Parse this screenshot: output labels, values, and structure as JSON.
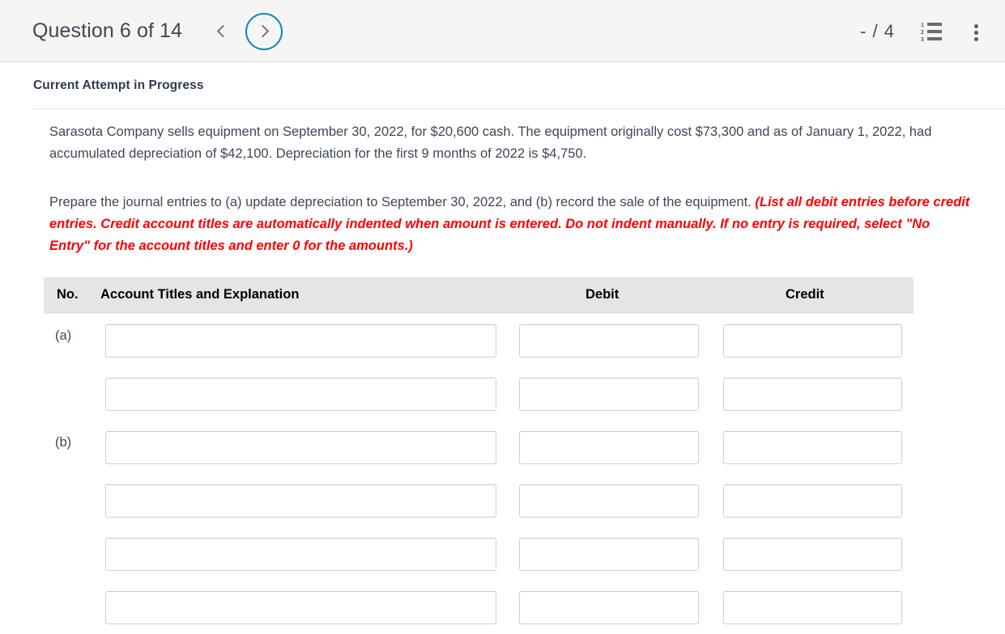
{
  "header": {
    "question_title": "Question 6 of 14",
    "prev_label": "Previous question",
    "next_label": "Next question",
    "score": "- / 4",
    "list_icon_label": "Question list",
    "menu_icon_label": "More options",
    "list_numbers": [
      "1",
      "2",
      "3"
    ],
    "accent_color": "#1387b2",
    "background_color": "#f5f5f5"
  },
  "attempt": {
    "status": "Current Attempt in Progress"
  },
  "question": {
    "paragraph_1": "Sarasota Company sells equipment on September 30, 2022, for $20,600 cash. The equipment originally cost $73,300 and as of January 1, 2022, had accumulated depreciation of $42,100. Depreciation for the first 9 months of 2022 is $4,750.",
    "paragraph_2_plain": "Prepare the journal entries to (a) update depreciation to September 30, 2022, and (b) record the sale of the equipment. ",
    "paragraph_2_italic": "(List all debit entries before credit entries. Credit account titles are automatically indented when amount is entered. Do not indent manually. If no entry is required, select \"No Entry\" for the account titles and enter 0 for the amounts.)",
    "instruction_color": "#ff0000"
  },
  "table": {
    "headers": {
      "no": "No.",
      "account": "Account Titles and Explanation",
      "debit": "Debit",
      "credit": "Credit"
    },
    "header_background": "#e5e5e5",
    "rows": [
      {
        "label": "(a)",
        "account": "",
        "debit": "",
        "credit": ""
      },
      {
        "label": "",
        "account": "",
        "debit": "",
        "credit": ""
      },
      {
        "label": "(b)",
        "account": "",
        "debit": "",
        "credit": ""
      },
      {
        "label": "",
        "account": "",
        "debit": "",
        "credit": ""
      },
      {
        "label": "",
        "account": "",
        "debit": "",
        "credit": ""
      },
      {
        "label": "",
        "account": "",
        "debit": "",
        "credit": ""
      }
    ]
  }
}
